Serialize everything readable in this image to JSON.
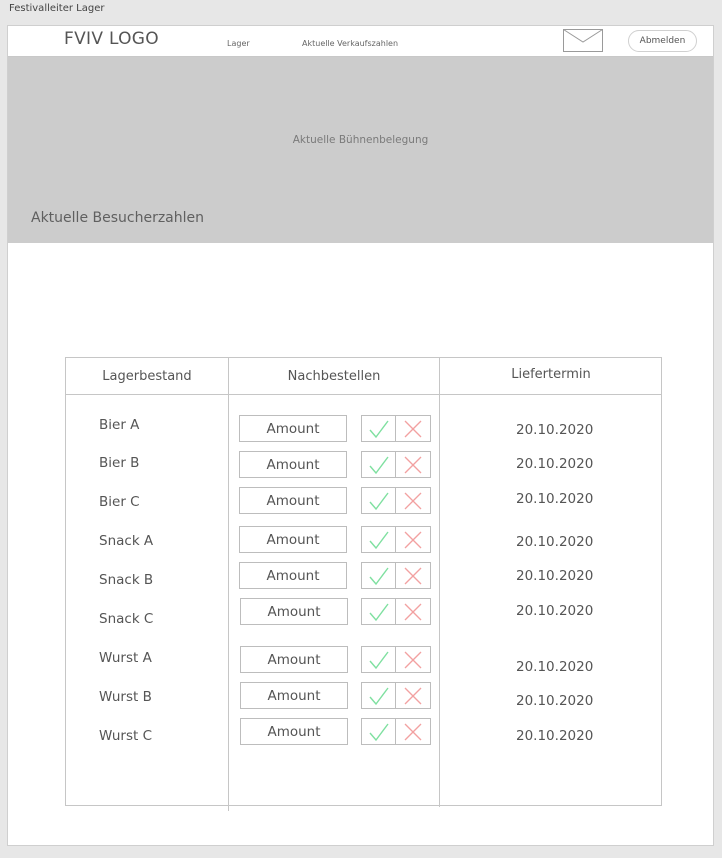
{
  "window": {
    "title": "Festivalleiter Lager"
  },
  "header": {
    "logo": "FVIV LOGO",
    "nav": [
      "Lager",
      "Aktuelle Verkaufszahlen"
    ],
    "logout_label": "Abmelden",
    "mail_icon": "mail-icon"
  },
  "hero": {
    "stage_label": "Aktuelle Bühnenbelegung",
    "visitors_label": "Aktuelle Besucherzahlen"
  },
  "table": {
    "headers": [
      "Lagerbestand",
      "Nachbestellen",
      "Liefertermin"
    ],
    "rows": [
      {
        "item": "Bier A",
        "amount_placeholder": "Amount",
        "date": "20.10.2020"
      },
      {
        "item": "Bier B",
        "amount_placeholder": "Amount",
        "date": "20.10.2020"
      },
      {
        "item": "Bier C",
        "amount_placeholder": "Amount",
        "date": "20.10.2020"
      },
      {
        "item": "Snack A",
        "amount_placeholder": "Amount",
        "date": "20.10.2020"
      },
      {
        "item": "Snack B",
        "amount_placeholder": "Amount",
        "date": "20.10.2020"
      },
      {
        "item": "Snack C",
        "amount_placeholder": "Amount",
        "date": "20.10.2020"
      },
      {
        "item": "Wurst A",
        "amount_placeholder": "Amount",
        "date": "20.10.2020"
      },
      {
        "item": "Wurst B",
        "amount_placeholder": "Amount",
        "date": "20.10.2020"
      },
      {
        "item": "Wurst C",
        "amount_placeholder": "Amount",
        "date": "20.10.2020"
      }
    ]
  },
  "colors": {
    "confirm": "#7fe0a0",
    "reject": "#f2a1a1",
    "hero_bg": "#cccccc"
  },
  "icons": {
    "confirm": "checkmark-icon",
    "reject": "x-icon"
  }
}
